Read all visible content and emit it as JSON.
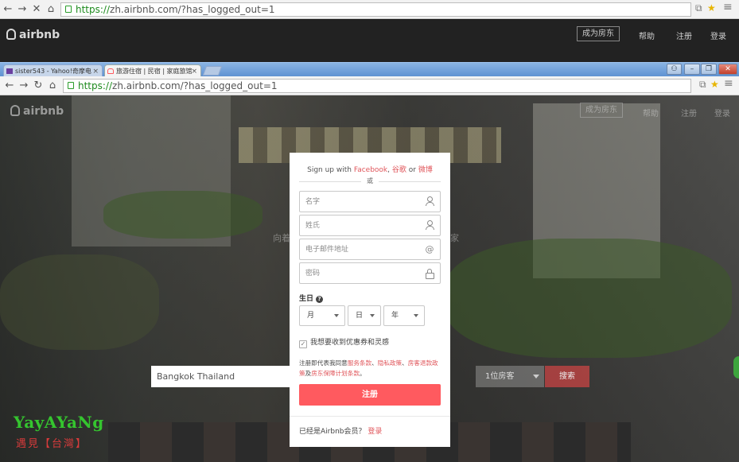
{
  "outer_browser": {
    "url_https": "https://",
    "url_rest": "zh.airbnb.com/?has_logged_out=1",
    "stop_glyph": "✕",
    "home_glyph": "⌂",
    "back_glyph": "←",
    "fwd_glyph": "→",
    "menu_glyph": "≡",
    "star_glyph": "★",
    "extra_icon": "⧉"
  },
  "outer_header": {
    "logo": "airbnb",
    "host_button": "成为房东",
    "nav": [
      "帮助",
      "注册",
      "登录"
    ]
  },
  "tabs": [
    {
      "label": "sister543 - Yahoo!奇摩电",
      "close": "×"
    },
    {
      "label": "旅游住宿 | 民宿 | 家庭旅馆",
      "close": "×"
    }
  ],
  "window_controls": {
    "user": "⚇",
    "minimize": "–",
    "maximize": "❐",
    "close": "✕"
  },
  "inner_browser": {
    "back_glyph": "←",
    "fwd_glyph": "→",
    "reload_glyph": "↻",
    "home_glyph": "⌂",
    "url_https": "https://",
    "url_rest": "zh.airbnb.com/?has_logged_out=1",
    "menu_glyph": "≡",
    "star_glyph": "★",
    "extra_icon": "⧉"
  },
  "page_header": {
    "logo": "airbnb",
    "host_button": "成为房东",
    "nav": [
      "帮助",
      "注册",
      "登录"
    ]
  },
  "hero": {
    "text_left": "向着",
    "text_right": "家"
  },
  "search": {
    "location_value": "Bangkok Thailand",
    "guests": "1位房客",
    "button": "搜索"
  },
  "watermark": {
    "line1": "YayAYaNg",
    "line2": "遇見【台灣】"
  },
  "modal": {
    "signup_prefix": "Sign up with ",
    "facebook": "Facebook",
    "google": "谷歌",
    "or_text": "or",
    "weibo": "微博",
    "comma": ", ",
    "divider_text": "或",
    "fields": {
      "first_name": "名字",
      "last_name": "姓氏",
      "email": "电子邮件地址",
      "password": "密码"
    },
    "email_icon": "@",
    "birthday_label": "生日",
    "help_glyph": "?",
    "month": "月",
    "day": "日",
    "year": "年",
    "promo_checkbox_mark": "✓",
    "promo_label": "我想要收到优惠券和灵感",
    "terms_prefix": "注册即代表我同意",
    "terms_service": "服务条款",
    "terms_sep1": "、",
    "terms_privacy": "隐私政策",
    "terms_sep2": "、",
    "terms_refund": "房客退款政策",
    "terms_and": "及",
    "terms_host": "房东保障计划条款",
    "terms_end": "。",
    "signup_button": "注册",
    "already_member": "已经是Airbnb会员？",
    "login_link": "登录"
  },
  "colors": {
    "brand": "#ff5a5f",
    "link": "#e0565b",
    "watermark_green": "#35c52f",
    "watermark_red": "#d73b3b"
  }
}
